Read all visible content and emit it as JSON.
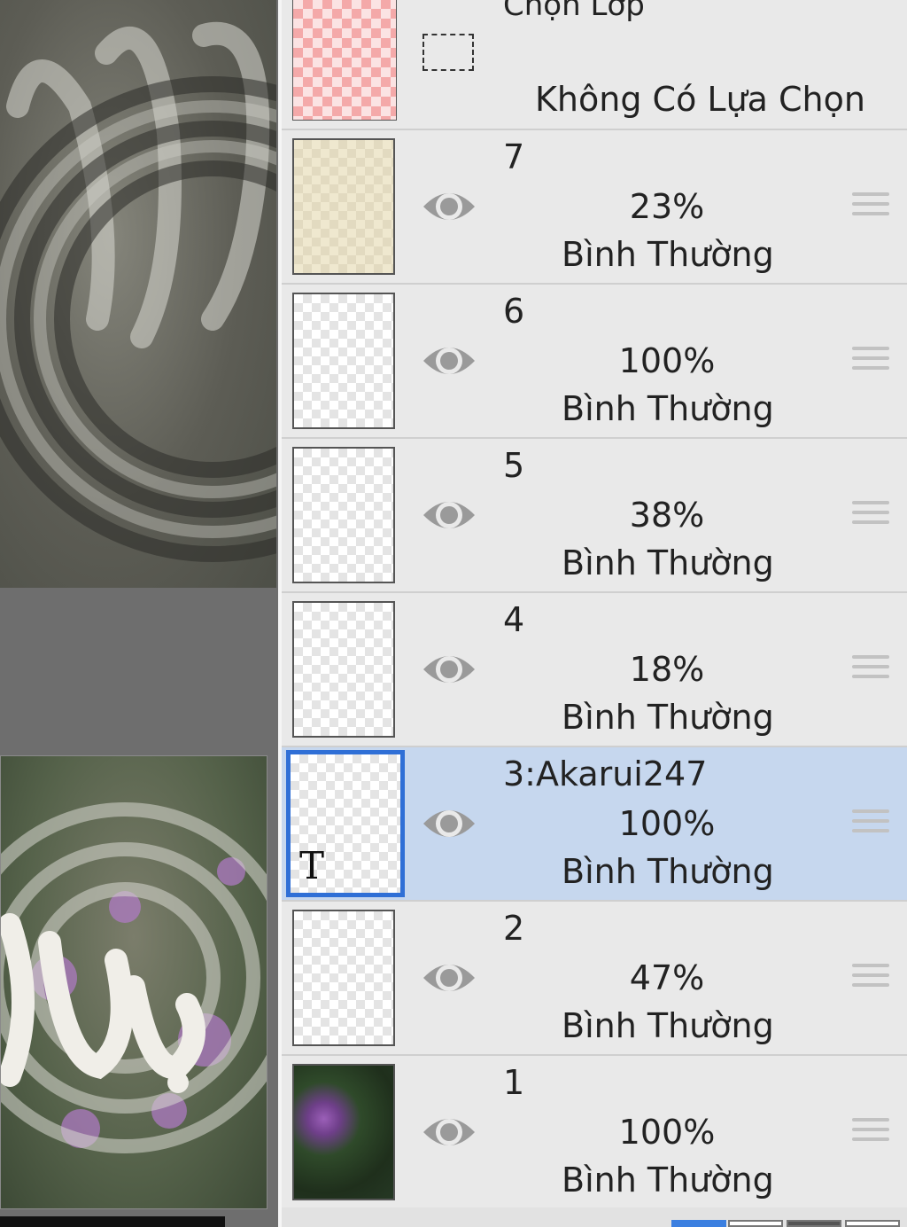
{
  "header": {
    "title": "Chọn Lớp",
    "selection_icon": "dashed-rect-select-icon",
    "selection_status": "Không Có Lựa Chọn"
  },
  "layers": [
    {
      "name": "7",
      "opacity": "23%",
      "blend": "Bình Thường",
      "visible": true,
      "selected": false,
      "thumb": "tint"
    },
    {
      "name": "6",
      "opacity": "100%",
      "blend": "Bình Thường",
      "visible": true,
      "selected": false,
      "thumb": "blank"
    },
    {
      "name": "5",
      "opacity": "38%",
      "blend": "Bình Thường",
      "visible": true,
      "selected": false,
      "thumb": "blank"
    },
    {
      "name": "4",
      "opacity": "18%",
      "blend": "Bình Thường",
      "visible": true,
      "selected": false,
      "thumb": "blank"
    },
    {
      "name": "3:Akarui247",
      "opacity": "100%",
      "blend": "Bình Thường",
      "visible": true,
      "selected": true,
      "thumb": "text",
      "type_glyph": "T"
    },
    {
      "name": "2",
      "opacity": "47%",
      "blend": "Bình Thường",
      "visible": true,
      "selected": false,
      "thumb": "blank"
    },
    {
      "name": "1",
      "opacity": "100%",
      "blend": "Bình Thường",
      "visible": true,
      "selected": false,
      "thumb": "photo"
    }
  ],
  "colors": {
    "selected_row": "#c6d7ee",
    "selected_border": "#2f6fd6",
    "accent": "#2f6fd6"
  }
}
